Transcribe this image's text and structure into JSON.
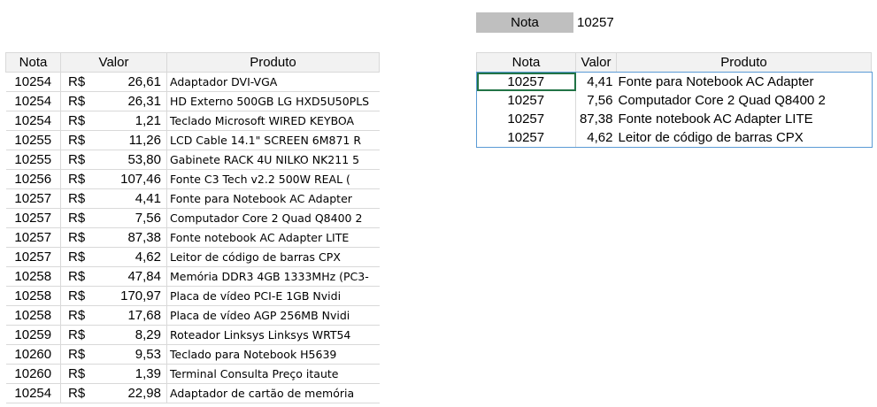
{
  "filter": {
    "label": "Nota",
    "value": "10257"
  },
  "left_table": {
    "headers": [
      "Nota",
      "Valor",
      "Produto"
    ],
    "currency": "R$",
    "rows": [
      {
        "nota": "10254",
        "valor": "26,61",
        "produto": "Adaptador DVI-VGA"
      },
      {
        "nota": "10254",
        "valor": "26,31",
        "produto": "HD Externo 500GB LG HXD5U50PLS"
      },
      {
        "nota": "10254",
        "valor": "1,21",
        "produto": "Teclado Microsoft WIRED KEYBOA"
      },
      {
        "nota": "10255",
        "valor": "11,26",
        "produto": "LCD Cable 14.1\" SCREEN 6M871 R"
      },
      {
        "nota": "10255",
        "valor": "53,80",
        "produto": "Gabinete RACK 4U NILKO NK211 5"
      },
      {
        "nota": "10256",
        "valor": "107,46",
        "produto": "Fonte C3 Tech v2.2 500W REAL ("
      },
      {
        "nota": "10257",
        "valor": "4,41",
        "produto": "Fonte para Notebook AC Adapter"
      },
      {
        "nota": "10257",
        "valor": "7,56",
        "produto": "Computador Core 2 Quad Q8400 2"
      },
      {
        "nota": "10257",
        "valor": "87,38",
        "produto": "Fonte notebook AC Adapter LITE"
      },
      {
        "nota": "10257",
        "valor": "4,62",
        "produto": "Leitor de código de barras CPX"
      },
      {
        "nota": "10258",
        "valor": "47,84",
        "produto": "Memória DDR3 4GB 1333MHz (PC3-"
      },
      {
        "nota": "10258",
        "valor": "170,97",
        "produto": "Placa de vídeo PCI-E 1GB Nvidi"
      },
      {
        "nota": "10258",
        "valor": "17,68",
        "produto": "Placa de vídeo AGP 256MB Nvidi"
      },
      {
        "nota": "10259",
        "valor": "8,29",
        "produto": "Roteador Linksys Linksys WRT54"
      },
      {
        "nota": "10260",
        "valor": "9,53",
        "produto": "Teclado para Notebook H5639"
      },
      {
        "nota": "10260",
        "valor": "1,39",
        "produto": "Terminal Consulta Preço itaute"
      },
      {
        "nota": "10254",
        "valor": "22,98",
        "produto": "Adaptador de cartão de memória"
      }
    ]
  },
  "right_table": {
    "headers": [
      "Nota",
      "Valor",
      "Produto"
    ],
    "rows": [
      {
        "nota": "10257",
        "valor": "4,41",
        "produto": "Fonte para Notebook AC Adapter"
      },
      {
        "nota": "10257",
        "valor": "7,56",
        "produto": "Computador Core 2 Quad Q8400 2"
      },
      {
        "nota": "10257",
        "valor": "87,38",
        "produto": "Fonte notebook AC Adapter LITE"
      },
      {
        "nota": "10257",
        "valor": "4,62",
        "produto": "Leitor de código de barras CPX"
      }
    ]
  },
  "colors": {
    "filter_bg": "#bfbfbf",
    "header_bg": "#f2f2f2",
    "grid": "#d9d9d9",
    "table_border": "#5b9bd5",
    "selection": "#217346"
  }
}
